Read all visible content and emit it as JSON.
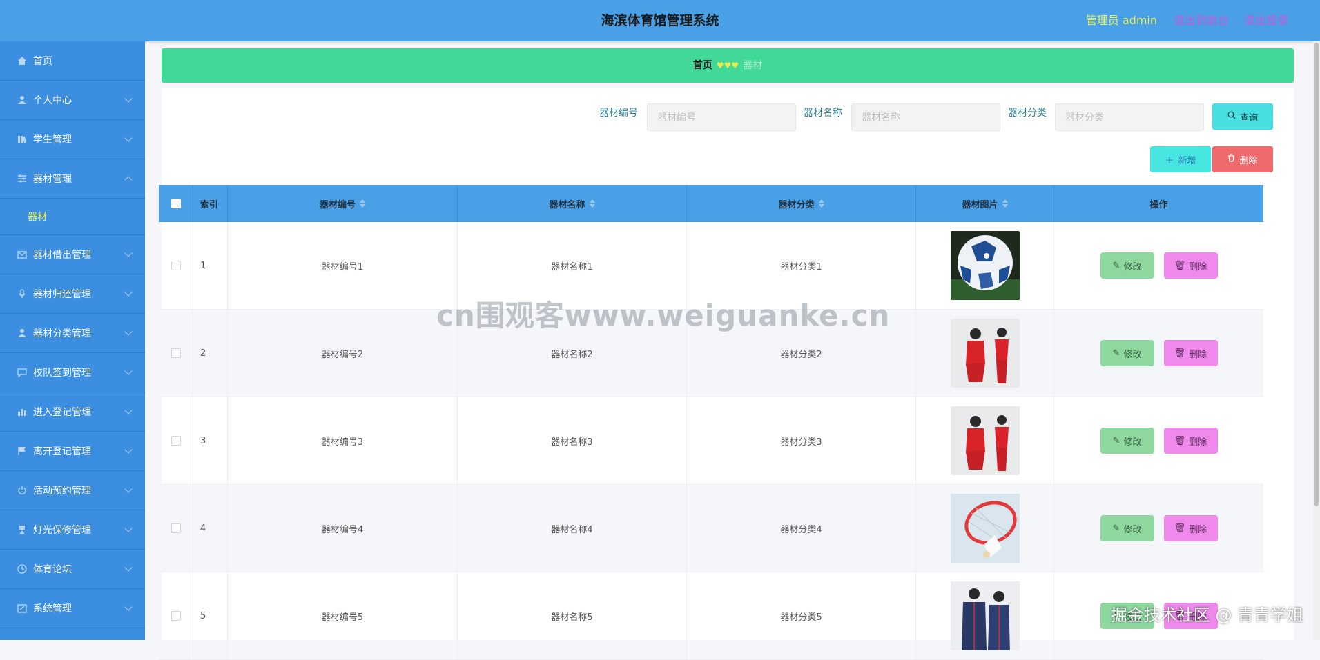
{
  "header": {
    "title": "海滨体育馆管理系统",
    "user": "管理员 admin",
    "to_front": "退出到前台",
    "logout": "退出登录"
  },
  "sidebar": {
    "items": [
      {
        "label": "首页",
        "icon": "home-icon"
      },
      {
        "label": "个人中心",
        "icon": "user-icon"
      },
      {
        "label": "学生管理",
        "icon": "library-icon"
      },
      {
        "label": "器材管理",
        "icon": "sliders-icon"
      },
      {
        "label": "器材借出管理",
        "icon": "mail-icon"
      },
      {
        "label": "器材归还管理",
        "icon": "microphone-icon"
      },
      {
        "label": "器材分类管理",
        "icon": "user-icon"
      },
      {
        "label": "校队签到管理",
        "icon": "chat-icon"
      },
      {
        "label": "进入登记管理",
        "icon": "bar-chart-icon"
      },
      {
        "label": "离开登记管理",
        "icon": "flag-icon"
      },
      {
        "label": "活动预约管理",
        "icon": "power-icon"
      },
      {
        "label": "灯光保修管理",
        "icon": "trophy-icon"
      },
      {
        "label": "体育论坛",
        "icon": "clock-icon"
      },
      {
        "label": "系统管理",
        "icon": "edit-icon"
      }
    ],
    "sub_item": "器材"
  },
  "breadcrumb": {
    "home": "首页",
    "sep": "♥♥♥",
    "current": "器材"
  },
  "search": {
    "code_label": "器材编号",
    "code_placeholder": "器材编号",
    "name_label": "器材名称",
    "name_placeholder": "器材名称",
    "cat_label": "器材分类",
    "cat_placeholder": "器材分类",
    "query_button": "查询"
  },
  "actions": {
    "add": "新增",
    "delete": "删除"
  },
  "table": {
    "headers": {
      "index": "索引",
      "code": "器材编号",
      "name": "器材名称",
      "cat": "器材分类",
      "image": "器材图片",
      "ops": "操作"
    },
    "edit_label": "修改",
    "delete_label": "删除",
    "rows": [
      {
        "index": "1",
        "code": "器材编号1",
        "name": "器材名称1",
        "cat": "器材分类1",
        "image": "soccer-ball"
      },
      {
        "index": "2",
        "code": "器材编号2",
        "name": "器材名称2",
        "cat": "器材分类2",
        "image": "red-tracksuit"
      },
      {
        "index": "3",
        "code": "器材编号3",
        "name": "器材名称3",
        "cat": "器材分类3",
        "image": "red-tracksuit"
      },
      {
        "index": "4",
        "code": "器材编号4",
        "name": "器材名称4",
        "cat": "器材分类4",
        "image": "badminton"
      },
      {
        "index": "5",
        "code": "器材编号5",
        "name": "器材名称5",
        "cat": "器材分类5",
        "image": "couple-jackets"
      }
    ]
  },
  "watermarks": {
    "center": "cn围观客www.weiguanke.cn",
    "corner": "掘金技术社区 @ 青青学姐"
  }
}
